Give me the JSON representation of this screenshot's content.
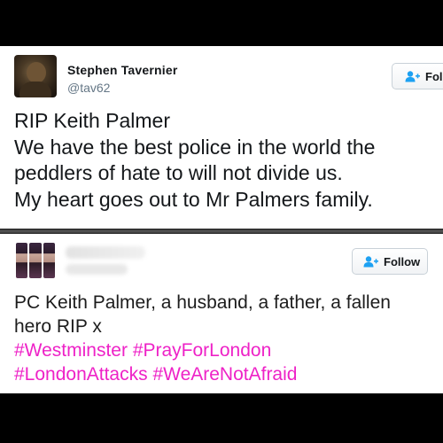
{
  "tweets": [
    {
      "name": "Stephen Tavernier",
      "handle": "@tav62",
      "follow_label": "Fol",
      "lines": [
        "RIP Keith Palmer",
        "We have the best police in the world the",
        "peddlers of hate to will not divide us.",
        "My heart goes out to Mr Palmers family."
      ]
    },
    {
      "follow_label": "Follow",
      "lines": [
        "PC Keith Palmer, a husband, a father, a fallen",
        "hero RIP x"
      ],
      "hashtag_lines": [
        "#Westminster #PrayForLondon",
        "#LondonAttacks #WeAreNotAfraid"
      ]
    }
  ],
  "colors": {
    "hashtag": "#ee22c7",
    "follow_icon": "#1da1f2"
  },
  "icons": {
    "follow": "add-user-icon"
  }
}
